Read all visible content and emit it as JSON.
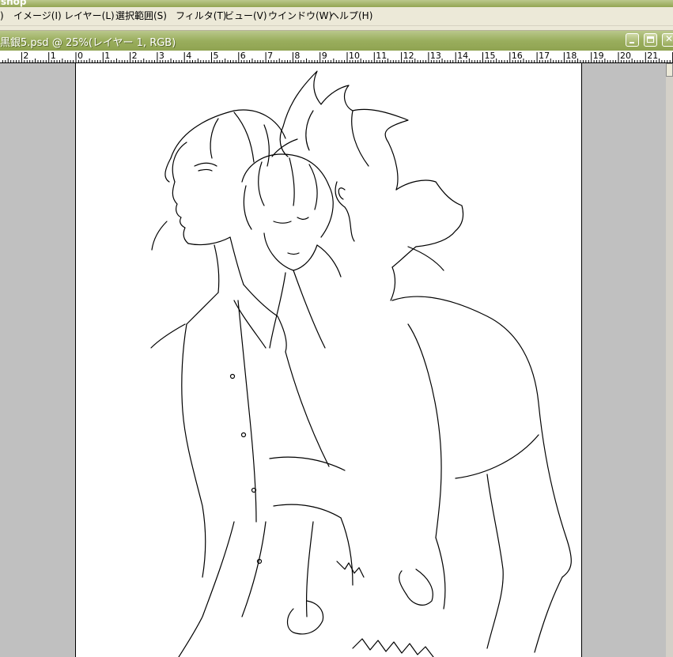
{
  "app": {
    "title": "shop"
  },
  "menu": {
    "items": [
      {
        "label": ")"
      },
      {
        "label": "イメージ(I)"
      },
      {
        "label": "レイヤー(L)"
      },
      {
        "label": "選択範囲(S)"
      },
      {
        "label": "フィルタ(T)"
      },
      {
        "label": "ビュー(V)"
      },
      {
        "label": "ウインドウ(W)"
      },
      {
        "label": "ヘルプ(H)"
      }
    ]
  },
  "document": {
    "title": "黒銀5.psd @ 25%(レイヤー 1, RGB)"
  },
  "ruler": {
    "labels": [
      "2",
      "1",
      "0",
      "1",
      "2",
      "3",
      "4",
      "5",
      "6",
      "7",
      "8",
      "9",
      "10",
      "11",
      "12",
      "13",
      "14",
      "15",
      "16",
      "17",
      "18",
      "19",
      "20",
      "21"
    ]
  },
  "colors": {
    "titlebar_green": "#9aae5d",
    "menubar": "#ece9d8",
    "workspace": "#c0c0c0",
    "canvas": "#ffffff"
  }
}
